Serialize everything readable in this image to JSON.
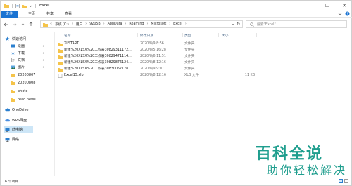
{
  "window": {
    "title": "Excel",
    "controls": {
      "minimize": "—",
      "maximize": "☐",
      "close": "✕"
    }
  },
  "ribbon": {
    "tabs": [
      "文件",
      "主页",
      "共享",
      "查看"
    ],
    "help": "?"
  },
  "address": {
    "crumbs": [
      "系统 (C:)",
      "用户",
      "9205B",
      "AppData",
      "Roaming",
      "Microsoft",
      "Excel"
    ],
    "search_placeholder": "搜索\"Excel\""
  },
  "nav": {
    "items": [
      {
        "label": "快速访问",
        "icon": "star-icon",
        "pinned": false
      },
      {
        "label": "桌面",
        "icon": "desktop-icon",
        "pinned": true
      },
      {
        "label": "下载",
        "icon": "download-icon",
        "pinned": true
      },
      {
        "label": "文档",
        "icon": "document-icon",
        "pinned": true
      },
      {
        "label": "图片",
        "icon": "picture-icon",
        "pinned": true
      },
      {
        "label": "20200807",
        "icon": "folder-icon",
        "pinned": false
      },
      {
        "label": "20200808",
        "icon": "folder-icon",
        "pinned": false
      },
      {
        "label": "photo",
        "icon": "folder-icon",
        "pinned": false
      },
      {
        "label": "read news",
        "icon": "folder-icon",
        "pinned": false
      },
      {
        "label": "OneDrive",
        "icon": "cloud-icon",
        "pinned": false
      },
      {
        "label": "WPS网盘",
        "icon": "cloud-icon",
        "pinned": false
      },
      {
        "label": "此电脑",
        "icon": "computer-icon",
        "pinned": false,
        "selected": true
      },
      {
        "label": "网络",
        "icon": "network-icon",
        "pinned": false
      }
    ]
  },
  "columns": {
    "name": "名称",
    "date": "修改日期",
    "type": "类型",
    "size": "大小"
  },
  "files": [
    {
      "name": "XLSTART",
      "date": "2020/8/9 8:56",
      "type": "文件夹",
      "size": "",
      "icon": "folder-icon"
    },
    {
      "name": "新建%20XLSX%20工作表30829311172...",
      "date": "2020/8/5 16:28",
      "type": "文件夹",
      "size": "",
      "icon": "folder-icon"
    },
    {
      "name": "新建%20XLSX%20工作表30829471114...",
      "date": "2020/8/6 11:51",
      "type": "文件夹",
      "size": "",
      "icon": "folder-icon"
    },
    {
      "name": "新建%20XLSX%20工作表30829876124...",
      "date": "2020/8/8 12:16",
      "type": "文件夹",
      "size": "",
      "icon": "folder-icon"
    },
    {
      "name": "新建%20XLSX%20工作表30830057178...",
      "date": "2020/8/9 9:07",
      "type": "文件夹",
      "size": "",
      "icon": "folder-icon"
    },
    {
      "name": "Excel15.xlb",
      "date": "2020/8/8 12:16",
      "type": "XLB 文件",
      "size": "11 KB",
      "icon": "file-icon"
    }
  ],
  "status": {
    "count": "6 个项目"
  },
  "watermark": {
    "title": "百科全说",
    "subtitle": "助你轻松解决"
  },
  "colors": {
    "accent": "#1a73d2",
    "folder": "#f5c44a",
    "selection": "#cde6f7",
    "watermark": "#1f9e8e"
  }
}
